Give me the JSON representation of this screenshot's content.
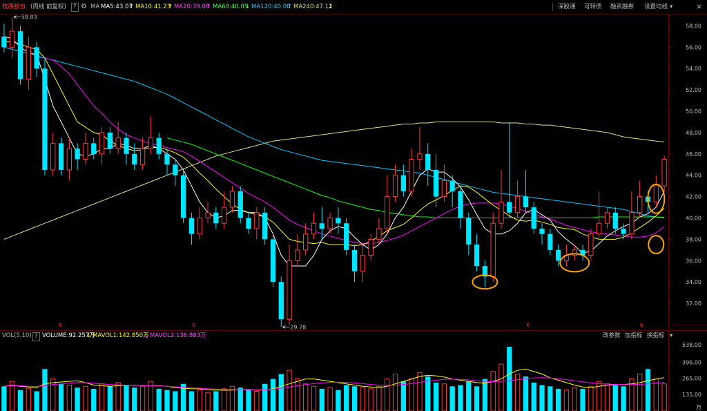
{
  "header": {
    "stock_name": "牧原股份",
    "period": "(周线 前复权)",
    "help": "?",
    "ma_label": "MA",
    "ma5": "MA5:43.07",
    "ma10": "MA10:41.23",
    "ma20": "MA20:39.06",
    "ma60": "MA60:40.05",
    "ma120": "MA120:40.00",
    "ma240": "MA240:47.12",
    "tabs": [
      "深股通",
      "可转债",
      "融资融券",
      "设置均线"
    ],
    "close": "×"
  },
  "volume_header": {
    "label": "VOL(5,10)",
    "help": "?",
    "volume": "VOLUME:92.257万",
    "mavol1": "MAVOL1:142.850万",
    "mavol2": "MAVOL2:136.883万",
    "buttons": [
      "改参数",
      "加指标",
      "换指标"
    ]
  },
  "colors": {
    "up": "#ff3b3b",
    "down": "#00e5ff",
    "ma5": "#ffffff",
    "ma10": "#ffff00",
    "ma20": "#ff00ff",
    "ma60": "#00ff00",
    "ma120": "#00c8ff",
    "ma240": "#e0e080",
    "annotation": "#ffa500"
  },
  "chart_data": {
    "type": "candlestick",
    "yaxis": {
      "ticks": [
        "58.00",
        "56.00",
        "54.00",
        "52.00",
        "50.00",
        "48.00",
        "46.00",
        "44.00",
        "42.00",
        "40.00",
        "38.00",
        "36.00",
        "34.00",
        "32.00"
      ],
      "range": [
        30.0,
        59.0
      ]
    },
    "vol_axis": {
      "ticks": [
        "538.00",
        "396.00",
        "265.00",
        "135.00",
        "万"
      ],
      "range": [
        0,
        560
      ]
    },
    "high_label": "58.83",
    "low_label": "29.78",
    "high_value": 58.83,
    "low_value": 29.78,
    "marker_label": "6",
    "marker_positions": [
      0.09,
      0.29,
      0.79,
      0.96
    ],
    "candles": [
      [
        57.0,
        56.0,
        58.2,
        55.5
      ],
      [
        56.0,
        57.5,
        58.8,
        55.0
      ],
      [
        57.5,
        53.0,
        58.0,
        52.5
      ],
      [
        53.0,
        56.0,
        57.0,
        52.0
      ],
      [
        56.0,
        54.0,
        56.5,
        53.2
      ],
      [
        54.0,
        44.5,
        55.0,
        44.0
      ],
      [
        44.5,
        47.0,
        48.0,
        44.0
      ],
      [
        47.0,
        44.5,
        47.5,
        44.0
      ],
      [
        44.5,
        46.5,
        47.5,
        43.5
      ],
      [
        46.5,
        45.5,
        47.0,
        44.5
      ],
      [
        45.5,
        47.0,
        48.0,
        45.0
      ],
      [
        47.0,
        46.0,
        47.5,
        45.5
      ],
      [
        46.0,
        48.0,
        48.5,
        45.0
      ],
      [
        48.0,
        46.5,
        48.5,
        46.0
      ],
      [
        46.5,
        47.5,
        49.0,
        46.0
      ],
      [
        47.5,
        46.0,
        48.0,
        45.0
      ],
      [
        46.0,
        45.0,
        47.0,
        44.5
      ],
      [
        45.0,
        46.5,
        47.5,
        44.5
      ],
      [
        46.5,
        47.5,
        49.5,
        46.0
      ],
      [
        47.5,
        46.0,
        48.0,
        45.5
      ],
      [
        46.0,
        45.0,
        46.5,
        44.0
      ],
      [
        45.0,
        44.0,
        45.5,
        43.0
      ],
      [
        44.0,
        40.0,
        44.5,
        39.5
      ],
      [
        40.0,
        38.5,
        40.5,
        37.5
      ],
      [
        38.5,
        40.0,
        41.0,
        38.0
      ],
      [
        40.0,
        40.5,
        41.5,
        39.5
      ],
      [
        40.5,
        39.5,
        41.0,
        39.0
      ],
      [
        39.5,
        41.0,
        42.5,
        39.0
      ],
      [
        41.0,
        42.5,
        43.0,
        40.5
      ],
      [
        42.5,
        40.0,
        43.0,
        39.5
      ],
      [
        40.0,
        39.0,
        40.5,
        38.5
      ],
      [
        39.0,
        40.5,
        41.0,
        38.0
      ],
      [
        40.5,
        38.0,
        41.0,
        37.5
      ],
      [
        38.0,
        34.0,
        38.5,
        33.5
      ],
      [
        34.0,
        30.5,
        34.5,
        29.8
      ],
      [
        30.5,
        36.0,
        37.5,
        30.0
      ],
      [
        36.0,
        37.0,
        38.5,
        35.5
      ],
      [
        37.0,
        38.5,
        39.5,
        36.5
      ],
      [
        38.5,
        39.5,
        40.5,
        38.0
      ],
      [
        39.5,
        39.0,
        41.0,
        38.0
      ],
      [
        39.0,
        40.0,
        40.5,
        38.5
      ],
      [
        40.0,
        39.5,
        41.0,
        38.5
      ],
      [
        39.5,
        37.0,
        40.0,
        36.5
      ],
      [
        37.0,
        35.0,
        37.5,
        34.0
      ],
      [
        35.0,
        36.5,
        37.5,
        34.0
      ],
      [
        36.5,
        38.0,
        38.5,
        36.0
      ],
      [
        38.0,
        39.0,
        40.0,
        37.5
      ],
      [
        39.0,
        42.0,
        44.0,
        38.5
      ],
      [
        42.0,
        44.0,
        45.0,
        41.5
      ],
      [
        44.0,
        42.5,
        45.0,
        42.0
      ],
      [
        42.5,
        45.5,
        46.5,
        42.0
      ],
      [
        45.5,
        46.0,
        48.5,
        44.5
      ],
      [
        46.0,
        44.5,
        47.0,
        43.0
      ],
      [
        44.5,
        42.0,
        46.0,
        41.0
      ],
      [
        42.0,
        43.5,
        45.0,
        41.5
      ],
      [
        43.5,
        42.5,
        44.0,
        41.0
      ],
      [
        42.5,
        40.0,
        43.0,
        39.0
      ],
      [
        40.0,
        37.5,
        40.5,
        36.5
      ],
      [
        37.5,
        35.5,
        38.5,
        35.0
      ],
      [
        35.5,
        34.5,
        36.0,
        33.5
      ],
      [
        34.5,
        39.5,
        40.5,
        34.0
      ],
      [
        39.5,
        41.5,
        44.5,
        39.0
      ],
      [
        41.5,
        40.5,
        49.0,
        40.0
      ],
      [
        40.5,
        42.0,
        43.5,
        40.0
      ],
      [
        42.0,
        41.0,
        44.5,
        40.5
      ],
      [
        41.0,
        39.0,
        41.5,
        38.5
      ],
      [
        39.0,
        38.5,
        39.5,
        37.5
      ],
      [
        38.5,
        37.0,
        39.0,
        36.5
      ],
      [
        37.0,
        36.0,
        37.5,
        35.5
      ],
      [
        36.0,
        36.5,
        37.5,
        35.5
      ],
      [
        36.5,
        37.0,
        37.5,
        36.0
      ],
      [
        37.0,
        36.5,
        37.5,
        36.0
      ],
      [
        36.5,
        38.5,
        39.0,
        36.0
      ],
      [
        38.5,
        39.5,
        42.5,
        38.0
      ],
      [
        39.5,
        40.5,
        41.0,
        39.0
      ],
      [
        40.5,
        39.0,
        41.0,
        38.5
      ],
      [
        39.0,
        38.5,
        39.5,
        38.0
      ],
      [
        38.5,
        40.5,
        42.5,
        38.0
      ],
      [
        40.5,
        42.0,
        43.5,
        40.0
      ],
      [
        42.0,
        41.5,
        42.5,
        40.5
      ],
      [
        41.5,
        43.0,
        44.0,
        41.0
      ],
      [
        43.0,
        45.5,
        45.8,
        42.5
      ]
    ],
    "ma5": [
      57.0,
      56.8,
      56.0,
      55.5,
      55.3,
      53.0,
      50.5,
      49.0,
      47.5,
      46.0,
      45.8,
      46.0,
      46.5,
      46.5,
      47.0,
      46.8,
      46.5,
      46.5,
      46.8,
      46.5,
      46.0,
      45.5,
      44.5,
      43.0,
      41.5,
      40.5,
      40.0,
      40.2,
      40.7,
      40.7,
      40.5,
      40.5,
      40.0,
      38.5,
      36.5,
      35.5,
      35.5,
      35.5,
      36.5,
      38.0,
      38.8,
      39.2,
      39.0,
      38.2,
      37.5,
      37.0,
      37.5,
      38.5,
      40.0,
      41.0,
      42.5,
      44.0,
      44.6,
      44.3,
      44.3,
      43.7,
      42.9,
      41.7,
      40.3,
      39.0,
      38.5,
      38.5,
      38.8,
      39.5,
      40.5,
      40.8,
      40.3,
      39.8,
      38.7,
      38.0,
      37.4,
      36.7,
      36.9,
      37.6,
      38.3,
      38.8,
      39.2,
      39.5,
      40.1,
      40.4,
      41.0,
      42.5
    ],
    "ma10": [
      56.5,
      56.5,
      56.3,
      56.0,
      55.8,
      55.0,
      53.5,
      52.0,
      50.5,
      49.0,
      48.5,
      48.0,
      47.8,
      47.2,
      46.8,
      46.5,
      46.3,
      46.4,
      46.6,
      46.6,
      46.4,
      46.1,
      45.7,
      45.0,
      44.2,
      43.5,
      42.7,
      42.0,
      41.3,
      40.8,
      40.5,
      40.3,
      40.1,
      39.6,
      38.8,
      38.0,
      37.8,
      37.7,
      37.6,
      37.7,
      37.5,
      37.5,
      37.5,
      37.4,
      37.5,
      37.8,
      38.3,
      38.8,
      39.1,
      39.4,
      40.0,
      40.7,
      41.3,
      41.7,
      42.1,
      42.6,
      43.0,
      42.9,
      42.4,
      41.8,
      41.2,
      40.7,
      40.2,
      39.8,
      39.7,
      39.8,
      39.6,
      39.4,
      39.1,
      39.0,
      38.9,
      38.5,
      38.2,
      38.0,
      38.0,
      38.0,
      38.2,
      38.6,
      39.1,
      39.6,
      40.2,
      40.9
    ],
    "ma20": [
      null,
      null,
      null,
      null,
      55.0,
      55.0,
      54.8,
      54.2,
      53.5,
      52.5,
      51.5,
      50.5,
      49.8,
      49.0,
      48.3,
      47.8,
      47.5,
      47.2,
      47.0,
      46.8,
      46.6,
      46.4,
      46.2,
      45.8,
      45.3,
      44.8,
      44.3,
      43.8,
      43.3,
      42.8,
      42.3,
      41.9,
      41.5,
      41.0,
      40.4,
      39.8,
      39.4,
      39.1,
      38.8,
      38.5,
      38.3,
      38.1,
      37.9,
      37.7,
      37.6,
      37.6,
      37.7,
      37.9,
      38.1,
      38.4,
      38.8,
      39.2,
      39.6,
      40.0,
      40.4,
      40.8,
      41.1,
      41.3,
      41.4,
      41.4,
      41.4,
      41.3,
      41.1,
      40.9,
      40.6,
      40.4,
      40.1,
      39.9,
      39.6,
      39.3,
      39.1,
      38.9,
      38.7,
      38.6,
      38.5,
      38.4,
      38.3,
      38.2,
      38.2,
      38.3,
      38.6,
      39.2
    ],
    "ma60": [
      null,
      null,
      null,
      null,
      null,
      null,
      null,
      null,
      null,
      null,
      null,
      null,
      null,
      null,
      null,
      null,
      null,
      null,
      null,
      null,
      47.5,
      47.3,
      47.1,
      46.9,
      46.6,
      46.3,
      46.0,
      45.7,
      45.4,
      45.1,
      44.8,
      44.5,
      44.2,
      43.9,
      43.6,
      43.3,
      43.0,
      42.7,
      42.4,
      42.1,
      41.9,
      41.6,
      41.4,
      41.2,
      41.0,
      40.8,
      40.7,
      40.5,
      40.4,
      40.3,
      40.2,
      40.1,
      40.1,
      40.0,
      40.0,
      40.0,
      40.0,
      40.0,
      40.0,
      40.0,
      40.0,
      40.0,
      40.0,
      40.0,
      40.0,
      40.0,
      40.0,
      40.0,
      40.0,
      40.0,
      40.0,
      40.0,
      40.0,
      40.1,
      40.1,
      40.1,
      40.1,
      40.1,
      40.1,
      40.1,
      40.1,
      40.05
    ],
    "ma120": [
      56.0,
      55.8,
      55.6,
      55.4,
      55.2,
      55.0,
      54.8,
      54.6,
      54.4,
      54.2,
      54.0,
      53.8,
      53.6,
      53.4,
      53.2,
      53.0,
      52.8,
      52.5,
      52.2,
      51.9,
      51.6,
      51.2,
      50.8,
      50.4,
      50.0,
      49.6,
      49.2,
      48.8,
      48.4,
      48.0,
      47.6,
      47.3,
      47.0,
      46.7,
      46.4,
      46.2,
      46.0,
      45.8,
      45.6,
      45.4,
      45.3,
      45.2,
      45.1,
      45.0,
      44.9,
      44.8,
      44.7,
      44.6,
      44.5,
      44.4,
      44.3,
      44.2,
      44.0,
      43.8,
      43.6,
      43.4,
      43.2,
      43.0,
      42.8,
      42.6,
      42.4,
      42.3,
      42.2,
      42.1,
      42.0,
      41.9,
      41.8,
      41.7,
      41.6,
      41.5,
      41.4,
      41.3,
      41.2,
      41.1,
      41.0,
      40.9,
      40.8,
      40.6,
      40.4,
      40.2,
      40.1,
      40.0
    ],
    "ma240": [
      38.0,
      38.3,
      38.6,
      38.9,
      39.2,
      39.5,
      39.8,
      40.1,
      40.4,
      40.7,
      41.0,
      41.3,
      41.6,
      41.9,
      42.2,
      42.5,
      42.8,
      43.1,
      43.4,
      43.7,
      44.0,
      44.3,
      44.6,
      44.9,
      45.2,
      45.5,
      45.8,
      46.0,
      46.2,
      46.4,
      46.6,
      46.8,
      47.0,
      47.2,
      47.3,
      47.4,
      47.5,
      47.6,
      47.7,
      47.8,
      47.9,
      48.0,
      48.1,
      48.2,
      48.3,
      48.4,
      48.5,
      48.6,
      48.7,
      48.8,
      48.8,
      48.9,
      48.9,
      49.0,
      49.0,
      49.0,
      49.0,
      49.0,
      49.0,
      49.0,
      49.0,
      48.9,
      48.9,
      48.9,
      48.8,
      48.8,
      48.7,
      48.7,
      48.6,
      48.5,
      48.4,
      48.3,
      48.2,
      48.1,
      48.0,
      47.8,
      47.6,
      47.5,
      47.4,
      47.3,
      47.2,
      47.12
    ],
    "volume": [
      200,
      240,
      170,
      180,
      160,
      340,
      260,
      220,
      210,
      190,
      200,
      180,
      220,
      200,
      230,
      210,
      190,
      200,
      240,
      180,
      170,
      160,
      220,
      160,
      170,
      150,
      160,
      180,
      200,
      190,
      170,
      160,
      220,
      260,
      300,
      330,
      260,
      220,
      200,
      180,
      190,
      170,
      210,
      200,
      190,
      180,
      200,
      260,
      300,
      240,
      260,
      310,
      280,
      230,
      220,
      200,
      210,
      240,
      200,
      260,
      320,
      380,
      520,
      300,
      280,
      230,
      210,
      200,
      180,
      170,
      190,
      180,
      200,
      240,
      220,
      210,
      200,
      260,
      300,
      340,
      260,
      220
    ],
    "mavol1": [
      200,
      210,
      200,
      195,
      190,
      220,
      230,
      235,
      240,
      245,
      230,
      210,
      205,
      200,
      205,
      210,
      210,
      205,
      205,
      205,
      200,
      190,
      185,
      180,
      180,
      172,
      170,
      168,
      170,
      175,
      175,
      170,
      170,
      180,
      200,
      220,
      240,
      260,
      260,
      250,
      240,
      230,
      220,
      210,
      200,
      195,
      190,
      200,
      220,
      240,
      260,
      280,
      290,
      285,
      275,
      260,
      250,
      240,
      230,
      225,
      240,
      260,
      300,
      330,
      340,
      320,
      300,
      270,
      250,
      230,
      210,
      195,
      190,
      200,
      210,
      215,
      215,
      220,
      230,
      245,
      260,
      270
    ],
    "mavol2": [
      200,
      205,
      205,
      200,
      198,
      205,
      215,
      220,
      225,
      230,
      230,
      225,
      220,
      215,
      212,
      210,
      208,
      206,
      204,
      203,
      200,
      196,
      192,
      188,
      185,
      180,
      177,
      175,
      174,
      174,
      173,
      172,
      172,
      176,
      185,
      195,
      205,
      215,
      222,
      228,
      232,
      234,
      232,
      228,
      222,
      215,
      210,
      208,
      210,
      215,
      222,
      232,
      242,
      250,
      256,
      258,
      256,
      252,
      246,
      240,
      238,
      240,
      246,
      254,
      262,
      268,
      270,
      268,
      262,
      254,
      245,
      236,
      228,
      222,
      218,
      216,
      214,
      214,
      216,
      220,
      226,
      232
    ]
  }
}
